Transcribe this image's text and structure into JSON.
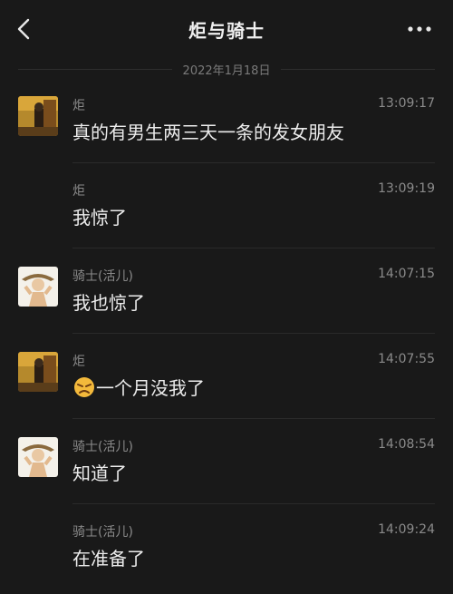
{
  "header": {
    "title": "炬与骑士",
    "back_icon": "chevron-left-icon",
    "more_icon": "more-dots-icon"
  },
  "date_divider": "2022年1月18日",
  "messages": [
    {
      "sender": "炬",
      "time": "13:09:17",
      "text": "真的有男生两三天一条的发女朋友",
      "avatar": "avatar-ju"
    },
    {
      "sender": "炬",
      "time": "13:09:19",
      "text": "我惊了",
      "avatar": ""
    },
    {
      "sender": "骑士(活儿)",
      "time": "14:07:15",
      "text": "我也惊了",
      "avatar": "avatar-knight"
    },
    {
      "sender": "炬",
      "time": "14:07:55",
      "text": "一个月没我了",
      "avatar": "avatar-ju",
      "emoji": "angry-face-emoji"
    },
    {
      "sender": "骑士(活儿)",
      "time": "14:08:54",
      "text": "知道了",
      "avatar": "avatar-knight"
    },
    {
      "sender": "骑士(活儿)",
      "time": "14:09:24",
      "text": "在准备了",
      "avatar": ""
    }
  ],
  "colors": {
    "background": "#191919",
    "text": "#ececec",
    "muted": "#8a8a8a",
    "emoji": "#f3b93b"
  }
}
